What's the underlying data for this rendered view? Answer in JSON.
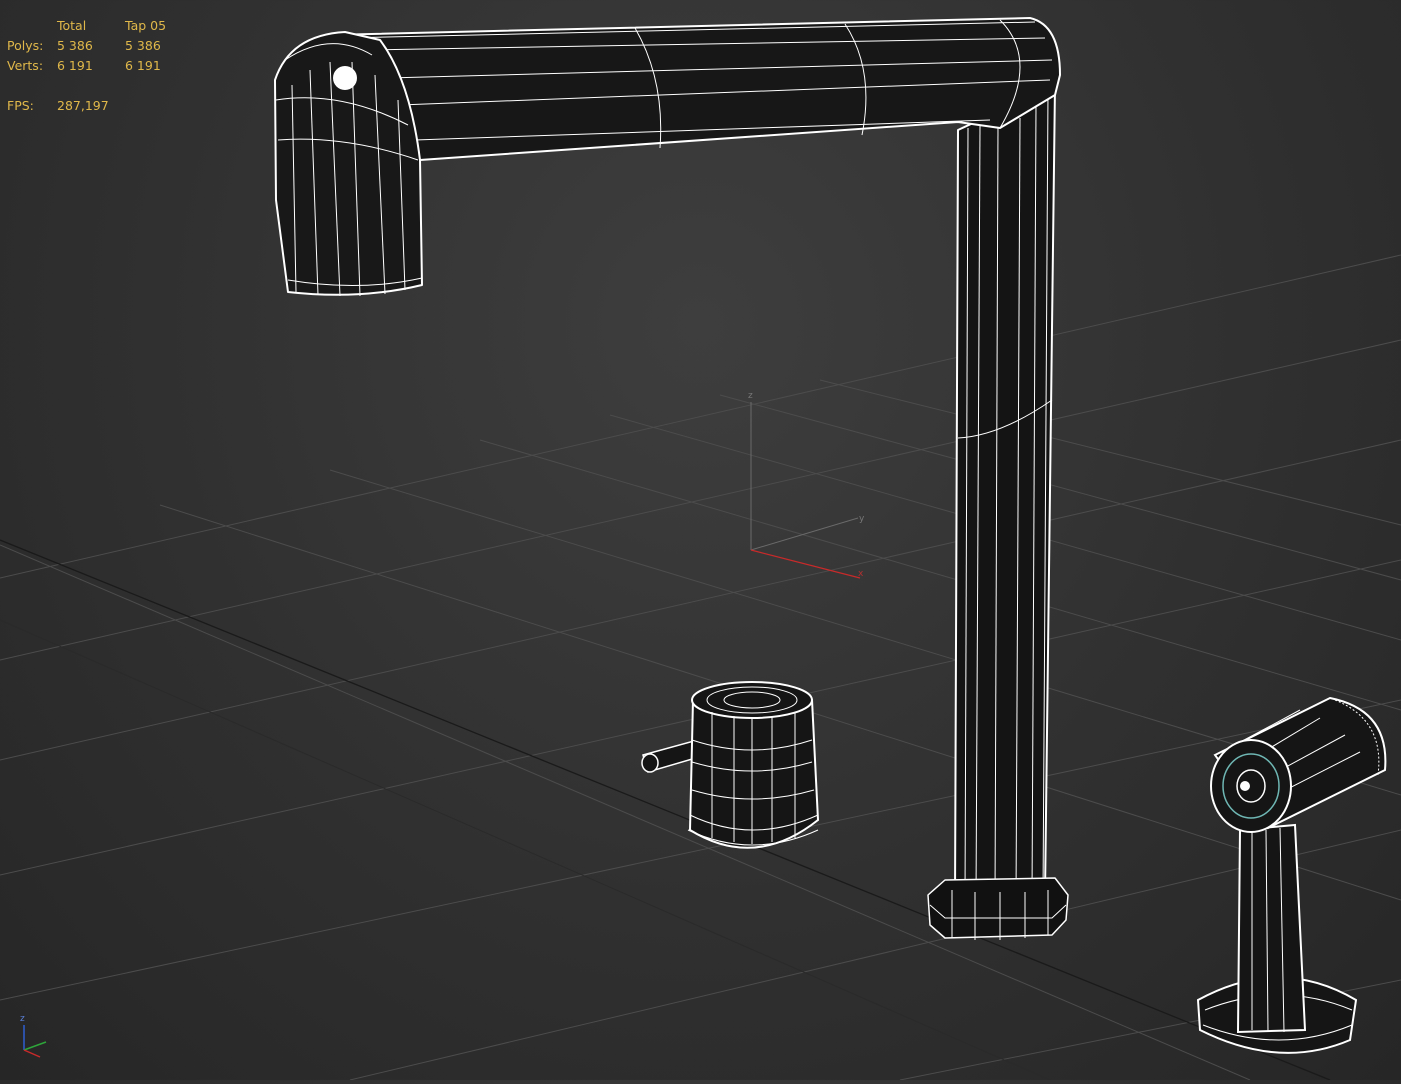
{
  "stats": {
    "headers": [
      "",
      "Total",
      "Tap 05"
    ],
    "polys": {
      "label": "Polys:",
      "total": "5 386",
      "object": "5 386"
    },
    "verts": {
      "label": "Verts:",
      "total": "6 191",
      "object": "6 191"
    },
    "fps": {
      "label": "FPS:",
      "value": "287,197"
    }
  },
  "gizmo": {
    "z": "z",
    "y": "y",
    "x": "x"
  },
  "corner_axis": {
    "z": "z"
  },
  "colors": {
    "background": "#333333",
    "stats_text": "#e0b84a",
    "grid": "#4a4a4a",
    "wire": "#ffffff",
    "x_axis": "#c82a2a",
    "y_axis": "#2ea53a",
    "z_axis": "#2f5fd0"
  }
}
